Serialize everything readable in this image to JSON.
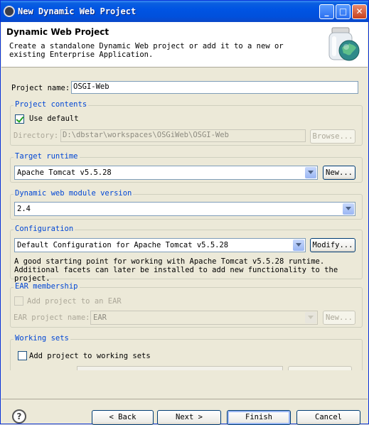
{
  "window": {
    "title": "New Dynamic Web Project",
    "minimize_glyph": "_",
    "maximize_glyph": "□",
    "close_glyph": "✕"
  },
  "banner": {
    "title": "Dynamic Web Project",
    "description": "Create a standalone Dynamic Web project or add it to a new or existing Enterprise Application.",
    "graphic_icon": "jar-globe-icon"
  },
  "project_name": {
    "label": "Project name:",
    "value": "OSGI-Web"
  },
  "project_contents": {
    "title": "Project contents",
    "use_default_label": "Use default",
    "use_default_checked": true,
    "directory_label": "Directory:",
    "directory_value": "D:\\dbstar\\workspaces\\OSGiWeb\\OSGI-Web",
    "browse_label": "Browse..."
  },
  "target_runtime": {
    "title": "Target runtime",
    "selected": "Apache Tomcat v5.5.28",
    "new_label": "New..."
  },
  "module_version": {
    "title": "Dynamic web module version",
    "selected": "2.4"
  },
  "configuration": {
    "title": "Configuration",
    "selected": "Default Configuration for Apache Tomcat v5.5.28",
    "modify_label": "Modify...",
    "description": "A good starting point for working with Apache Tomcat v5.5.28 runtime. Additional facets can later be installed to add new functionality to the project."
  },
  "ear_membership": {
    "title": "EAR membership",
    "add_label": "Add project to an EAR",
    "add_checked": false,
    "name_label": "EAR project name:",
    "name_value": "EAR",
    "new_label": "New..."
  },
  "working_sets": {
    "title": "Working sets",
    "add_label": "Add project to working sets",
    "add_checked": false
  },
  "footer": {
    "help_glyph": "?",
    "back_label": "< Back",
    "next_label": "Next >",
    "finish_label": "Finish",
    "cancel_label": "Cancel"
  }
}
